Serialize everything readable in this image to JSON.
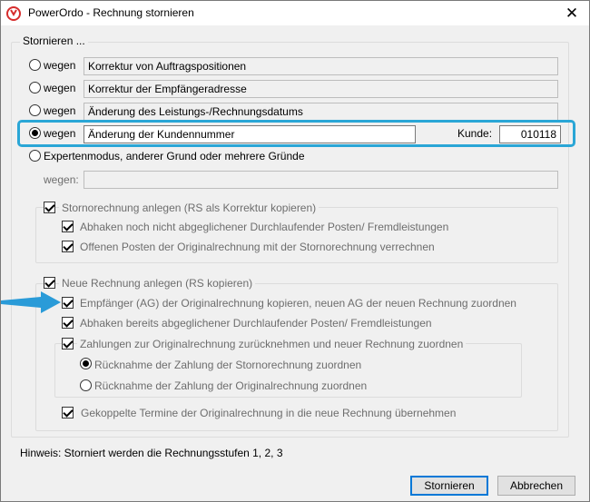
{
  "window": {
    "title": "PowerOrdo - Rechnung stornieren",
    "close_glyph": "✕"
  },
  "group_stornieren": {
    "label": "Stornieren ..."
  },
  "reasons": [
    {
      "radio_label": "wegen",
      "text": "Korrektur von Auftragspositionen",
      "selected": false
    },
    {
      "radio_label": "wegen",
      "text": "Korrektur der Empfängeradresse",
      "selected": false
    },
    {
      "radio_label": "wegen",
      "text": "Änderung des Leistungs-/Rechnungsdatums",
      "selected": false
    },
    {
      "radio_label": "wegen",
      "text": "Änderung der Kundennummer",
      "selected": true
    }
  ],
  "kunde": {
    "label": "Kunde:",
    "value": "010118"
  },
  "expert": {
    "label": "Expertenmodus, anderer Grund oder mehrere Gründe",
    "wegen_label": "wegen:",
    "wegen_value": ""
  },
  "storno_group": {
    "label": "Stornorechnung anlegen (RS als Korrektur kopieren)",
    "options": [
      "Abhaken noch nicht abgeglichener Durchlaufender Posten/ Fremdleistungen",
      "Offenen Posten der Originalrechnung mit der Stornorechnung verrechnen"
    ]
  },
  "neue_group": {
    "label": "Neue Rechnung anlegen (RS kopieren)",
    "options": [
      "Empfänger (AG) der Originalrechnung kopieren, neuen AG der neuen Rechnung zuordnen",
      "Abhaken bereits abgeglichener Durchlaufender Posten/ Fremdleistungen"
    ],
    "zahlungen": {
      "label": "Zahlungen zur Originalrechnung zurücknehmen und neuer Rechnung zuordnen",
      "radios": [
        "Rücknahme der Zahlung der Stornorechnung zuordnen",
        "Rücknahme der Zahlung der Originalrechnung zuordnen"
      ]
    },
    "termine": "Gekoppelte Termine der Originalrechnung in die neue Rechnung übernehmen"
  },
  "hinweis": "Hinweis: Storniert werden die Rechnungsstufen 1, 2, 3",
  "buttons": {
    "stornieren": "Stornieren",
    "abbrechen": "Abbrechen"
  },
  "colors": {
    "highlight": "#2aa6d6",
    "arrow": "#2a9bd8",
    "app_icon": "#d62d2d"
  }
}
